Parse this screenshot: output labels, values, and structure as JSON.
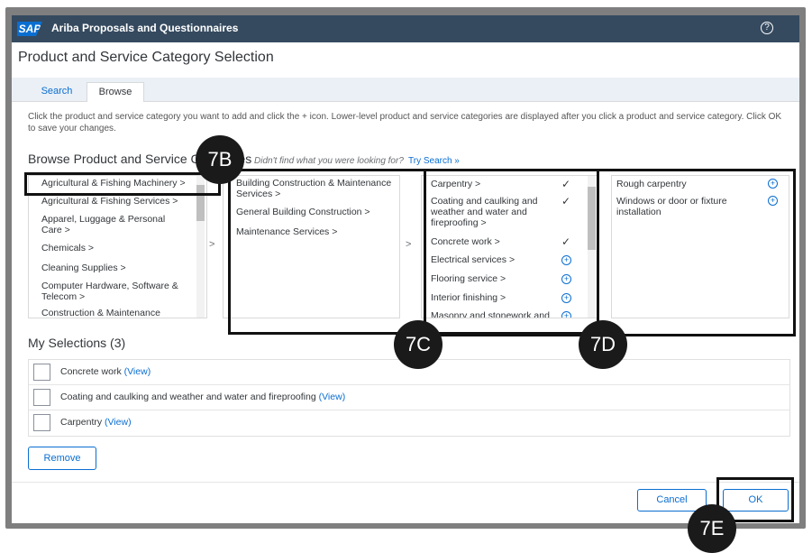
{
  "shell": {
    "logo": "SAP",
    "app_title": "Ariba Proposals and Questionnaires",
    "caret": "⌄",
    "help_icon": "question-circle-icon",
    "help_glyph": "?"
  },
  "page": {
    "title": "Product and Service Category Selection"
  },
  "tabs": [
    {
      "label": "Search"
    },
    {
      "label": "Browse"
    }
  ],
  "instructions": "Click the product and service category you want to add and click the + icon. Lower-level product and service categories are displayed after you click a product and service category. Click OK to save your changes.",
  "browse": {
    "title": "Browse Product and Service Categories",
    "missing_text": "Didn't find what you were looking for?",
    "try_search": "Try Search »"
  },
  "columns": {
    "col1": [
      "Agricultural & Fishing Machinery >",
      "Agricultural & Fishing Services >",
      "Apparel, Luggage & Personal Care >",
      "Chemicals >",
      "Cleaning Supplies >",
      "Computer Hardware, Software & Telecom >",
      "Construction & Maintenance"
    ],
    "col2": [
      "Building Construction & Maintenance Services >",
      "General Building Construction >",
      "Maintenance Services >"
    ],
    "col3": [
      {
        "label": "Carpentry >",
        "state": "check"
      },
      {
        "label": "Coating and caulking and weather and water and fireproofing >",
        "state": "check"
      },
      {
        "label": "Concrete work >",
        "state": "check"
      },
      {
        "label": "Electrical services >",
        "state": "plus"
      },
      {
        "label": "Flooring service >",
        "state": "plus"
      },
      {
        "label": "Interior finishing >",
        "state": "plus"
      },
      {
        "label": "Masonry and stonework and",
        "state": "plus"
      }
    ],
    "col4": [
      {
        "label": "Rough carpentry",
        "state": "plus"
      },
      {
        "label": "Windows or door or fixture installation",
        "state": "plus"
      }
    ],
    "arrow_glyph": ">",
    "check_glyph": "✓",
    "plus_glyph": "+"
  },
  "selections": {
    "title": "My Selections (3)",
    "rows": [
      {
        "text": "Concrete work",
        "link": "(View)"
      },
      {
        "text": "Coating and caulking and weather and water and fireproofing",
        "link": "(View)"
      },
      {
        "text": "Carpentry",
        "link": "(View)"
      }
    ]
  },
  "buttons": {
    "remove": "Remove",
    "cancel": "Cancel",
    "ok": "OK"
  },
  "callouts": {
    "b7": "7B",
    "c7": "7C",
    "d7": "7D",
    "e7": "7E"
  }
}
